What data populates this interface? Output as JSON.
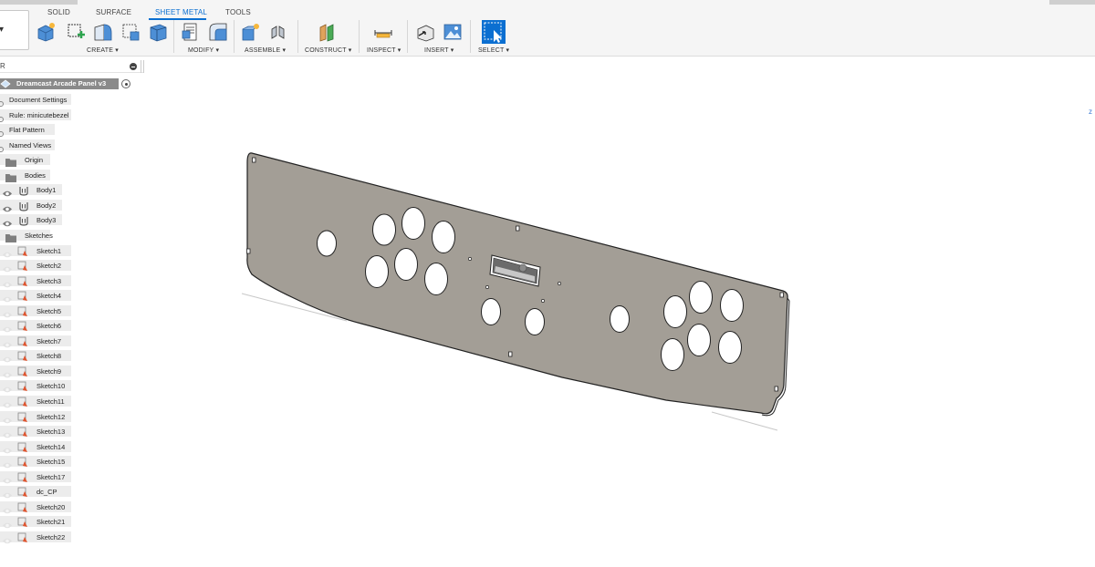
{
  "ribbon": {
    "tabs": [
      {
        "label": "SOLID",
        "active": false
      },
      {
        "label": "SURFACE",
        "active": false
      },
      {
        "label": "SHEET METAL",
        "active": true
      },
      {
        "label": "TOOLS",
        "active": false
      }
    ],
    "groups": {
      "create": "CREATE ▾",
      "modify": "MODIFY ▾",
      "assemble": "ASSEMBLE ▾",
      "construct": "CONSTRUCT ▾",
      "inspect": "INSPECT ▾",
      "insert": "INSERT ▾",
      "select": "SELECT ▾"
    },
    "accent": "#0b6fd1"
  },
  "browser": {
    "header": "R",
    "root": "Dreamcast Arcade Panel v3",
    "items": [
      {
        "label": "Document Settings",
        "type": "setting"
      },
      {
        "label": "Rule: minicutebezel",
        "type": "setting"
      },
      {
        "label": "Flat Pattern",
        "type": "setting"
      },
      {
        "label": "Named Views",
        "type": "setting"
      },
      {
        "label": "Origin",
        "type": "folder"
      },
      {
        "label": "Bodies",
        "type": "folder"
      },
      {
        "label": "Body1",
        "type": "body"
      },
      {
        "label": "Body2",
        "type": "body"
      },
      {
        "label": "Body3",
        "type": "body"
      },
      {
        "label": "Sketches",
        "type": "folder"
      },
      {
        "label": "Sketch1",
        "type": "sketch"
      },
      {
        "label": "Sketch2",
        "type": "sketch"
      },
      {
        "label": "Sketch3",
        "type": "sketch"
      },
      {
        "label": "Sketch4",
        "type": "sketch"
      },
      {
        "label": "Sketch5",
        "type": "sketch"
      },
      {
        "label": "Sketch6",
        "type": "sketch"
      },
      {
        "label": "Sketch7",
        "type": "sketch"
      },
      {
        "label": "Sketch8",
        "type": "sketch"
      },
      {
        "label": "Sketch9",
        "type": "sketch"
      },
      {
        "label": "Sketch10",
        "type": "sketch"
      },
      {
        "label": "Sketch11",
        "type": "sketch"
      },
      {
        "label": "Sketch12",
        "type": "sketch"
      },
      {
        "label": "Sketch13",
        "type": "sketch"
      },
      {
        "label": "Sketch14",
        "type": "sketch"
      },
      {
        "label": "Sketch15",
        "type": "sketch"
      },
      {
        "label": "Sketch17",
        "type": "sketch"
      },
      {
        "label": "dc_CP",
        "type": "sketch"
      },
      {
        "label": "Sketch20",
        "type": "sketch"
      },
      {
        "label": "Sketch21",
        "type": "sketch"
      },
      {
        "label": "Sketch22",
        "type": "sketch"
      }
    ]
  },
  "viewport": {
    "panel_color": "#a39e96",
    "edge_color": "#2a2a2a"
  }
}
